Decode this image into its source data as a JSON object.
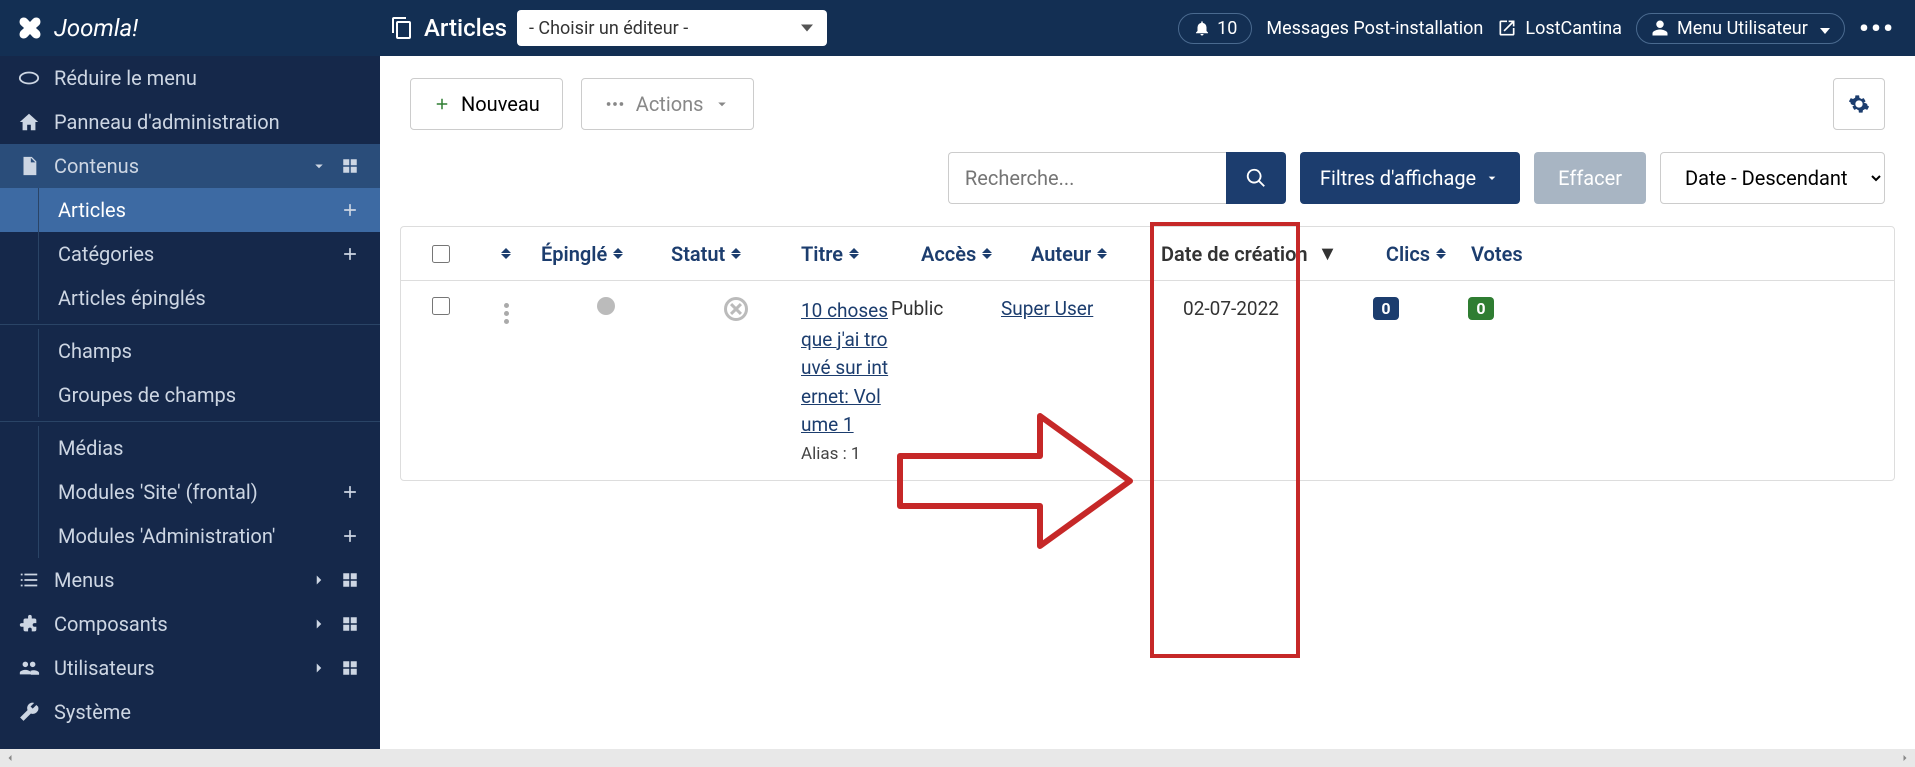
{
  "brand": "Joomla!",
  "page_title": "Articles",
  "editor_placeholder": "- Choisir un éditeur -",
  "notif_count": "10",
  "post_install": "Messages Post-installation",
  "site_name": "LostCantina",
  "user_menu": "Menu Utilisateur",
  "sidebar": {
    "collapse": "Réduire le menu",
    "admin_panel": "Panneau d'administration",
    "content": "Contenus",
    "articles": "Articles",
    "categories": "Catégories",
    "pinned_articles": "Articles épinglés",
    "fields": "Champs",
    "field_groups": "Groupes de champs",
    "media": "Médias",
    "modules_site": "Modules 'Site' (frontal)",
    "modules_admin": "Modules 'Administration'",
    "menus": "Menus",
    "components": "Composants",
    "users": "Utilisateurs",
    "system": "Système"
  },
  "toolbar": {
    "new": "Nouveau",
    "actions": "Actions"
  },
  "filters": {
    "search_placeholder": "Recherche...",
    "filter_options": "Filtres d'affichage",
    "clear": "Effacer",
    "sort": "Date - Descendant"
  },
  "columns": {
    "pinned": "Épinglé",
    "status": "Statut",
    "title": "Titre",
    "access": "Accès",
    "author": "Auteur",
    "created": "Date de création",
    "clicks": "Clics",
    "votes": "Votes"
  },
  "rows": [
    {
      "title": "10 choses que j'ai trouvé sur internet: Volume 1",
      "alias": "Alias : 1",
      "access": "Public",
      "author": "Super User",
      "date": "02-07-2022",
      "clicks": "0",
      "votes": "0"
    }
  ]
}
